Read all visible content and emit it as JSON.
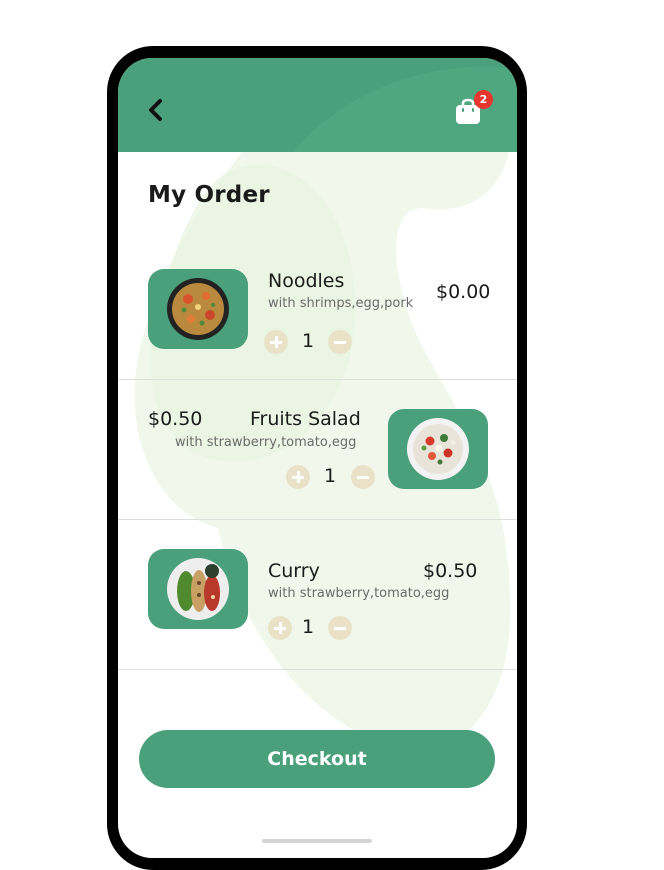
{
  "header": {
    "cart_count": "2",
    "icons": {
      "back": "chevron-left-icon",
      "cart": "shopping-bag-icon"
    },
    "color": "#49a07a"
  },
  "page": {
    "title": "My Order"
  },
  "items": [
    {
      "name": "Noodles",
      "description": "with shrimps,egg,pork",
      "price": "$0.00",
      "quantity": "1",
      "image": "noodles-bowl"
    },
    {
      "name": "Fruits Salad",
      "description": "with strawberry,tomato,egg",
      "price": "$0.50",
      "quantity": "1",
      "image": "salad-bowl"
    },
    {
      "name": "Curry",
      "description": "with strawberry,tomato,egg",
      "price": "$0.50",
      "quantity": "1",
      "image": "curry-platter"
    }
  ],
  "checkout": {
    "label": "Checkout"
  },
  "colors": {
    "accent": "#49a07a",
    "qty_button": "#e9e2c8",
    "badge": "#e8362e"
  }
}
